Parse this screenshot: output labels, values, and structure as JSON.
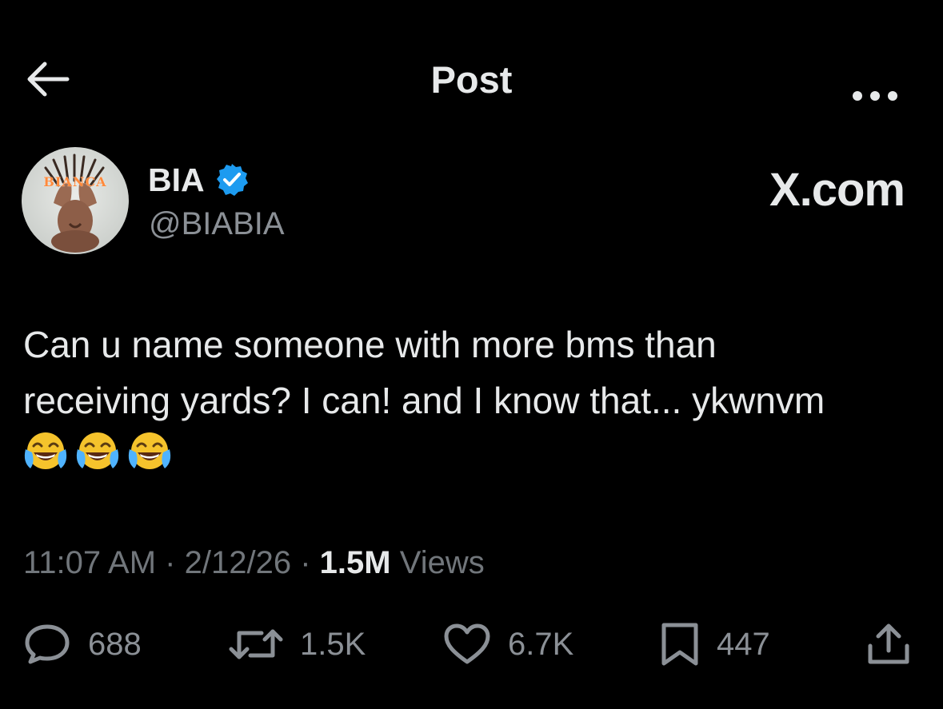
{
  "header": {
    "title": "Post",
    "back_icon": "arrow-left-icon",
    "more_icon": "more-horizontal-icon"
  },
  "author": {
    "name": "BIA",
    "handle": "@BIABIA",
    "verified": true,
    "avatar_text": "BIANCA"
  },
  "source_label": "X.com",
  "tweet": {
    "line1": "Can u name someone with more bms than",
    "line2": "receiving yards? I can! and I know that... ykwnvm",
    "emojis": [
      "face-with-tears-of-joy",
      "face-with-tears-of-joy",
      "face-with-tears-of-joy"
    ]
  },
  "meta": {
    "time": "11:07 AM",
    "date": "2/12/26",
    "sep": "·",
    "views_count": "1.5M",
    "views_label": "Views"
  },
  "actions": {
    "replies": "688",
    "reposts": "1.5K",
    "likes": "6.7K",
    "bookmarks": "447"
  },
  "colors": {
    "background": "#000000",
    "text": "#e7e9ea",
    "secondary": "#71767b",
    "verified_blue": "#1d9bf0"
  }
}
